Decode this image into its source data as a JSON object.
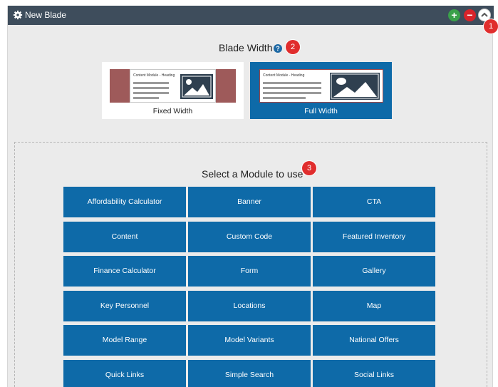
{
  "header": {
    "title": "New Blade",
    "icons": {
      "settings": "gear-icon",
      "add": "plus-icon",
      "remove": "minus-icon",
      "collapse": "chevron-up-icon"
    },
    "colors": {
      "bar": "#3e4d5c",
      "add": "#3aa14a",
      "remove": "#d8232a"
    }
  },
  "callouts": [
    "1",
    "2",
    "3"
  ],
  "blade_width": {
    "title": "Blade Width",
    "help_icon": "question-icon",
    "options": [
      {
        "label": "Fixed Width",
        "thumb_heading": "Content Module - Heading",
        "selected": false
      },
      {
        "label": "Full Width",
        "thumb_heading": "Content Module - Heading",
        "selected": true
      }
    ]
  },
  "modules": {
    "title": "Select a Module to use",
    "accent": "#0e6aa8",
    "items": [
      "Affordability Calculator",
      "Banner",
      "CTA",
      "Content",
      "Custom Code",
      "Featured Inventory",
      "Finance Calculator",
      "Form",
      "Gallery",
      "Key Personnel",
      "Locations",
      "Map",
      "Model Range",
      "Model Variants",
      "National Offers",
      "Quick Links",
      "Simple Search",
      "Social Links"
    ]
  }
}
